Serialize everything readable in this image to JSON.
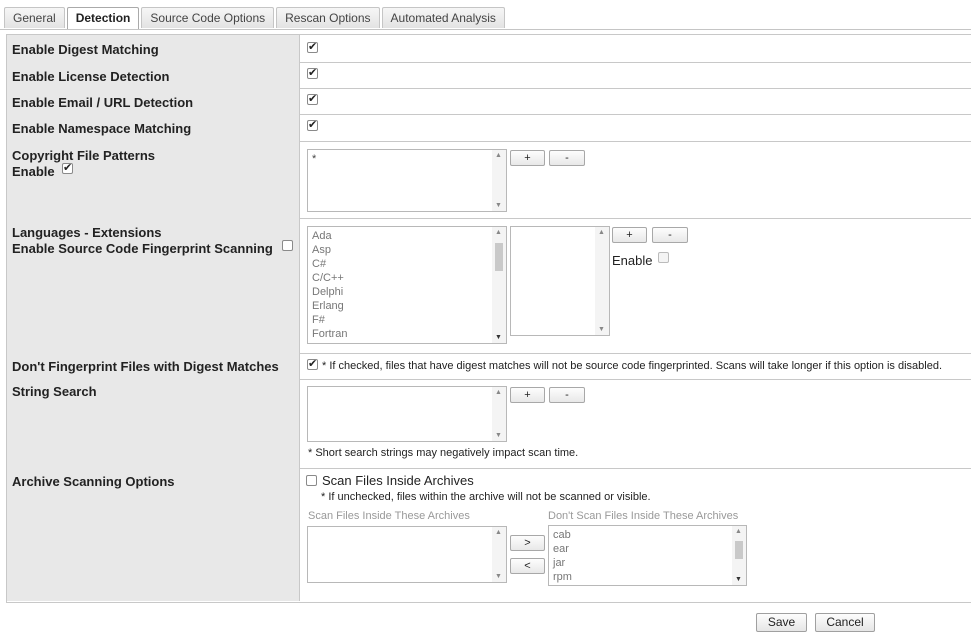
{
  "tabs": [
    "General",
    "Detection",
    "Source Code Options",
    "Rescan Options",
    "Automated Analysis"
  ],
  "active_tab": "Detection",
  "rows": {
    "digest": {
      "label": "Enable Digest Matching",
      "checked": true
    },
    "license": {
      "label": "Enable License Detection",
      "checked": true
    },
    "email": {
      "label": "Enable Email / URL Detection",
      "checked": true
    },
    "namespace": {
      "label": "Enable Namespace Matching",
      "checked": true
    },
    "copyright": {
      "label": "Copyright File Patterns",
      "enable_label": "Enable",
      "enable_checked": true,
      "patterns": [
        "*"
      ],
      "add": "+",
      "remove": "-"
    },
    "languages": {
      "label": "Languages - Extensions",
      "fingerprint_label": "Enable Source Code Fingerprint Scanning",
      "fingerprint_checked": false,
      "languages": [
        "Ada",
        "Asp",
        "C#",
        "C/C++",
        "Delphi",
        "Erlang",
        "F#",
        "Fortran"
      ],
      "add": "+",
      "remove": "-",
      "enable_label": "Enable",
      "enable_checked": false
    },
    "dont_fingerprint": {
      "label": "Don't Fingerprint Files with Digest Matches",
      "checked": true,
      "note": "* If checked, files that have digest matches will not be source code fingerprinted. Scans will take longer if this option is disabled."
    },
    "string_search": {
      "label": "String Search",
      "add": "+",
      "remove": "-",
      "note": "* Short search strings may negatively impact scan time."
    },
    "archive": {
      "label": "Archive Scanning Options",
      "scan_label": "Scan Files Inside Archives",
      "scan_checked": false,
      "note": "* If unchecked, files within the archive will not be scanned or visible.",
      "include_label": "Scan Files Inside These Archives",
      "exclude_label": "Don't Scan Files Inside These Archives",
      "move_right": ">",
      "move_left": "<",
      "excluded": [
        "cab",
        "ear",
        "jar",
        "rpm"
      ]
    }
  },
  "footer": {
    "save": "Save",
    "cancel": "Cancel"
  }
}
